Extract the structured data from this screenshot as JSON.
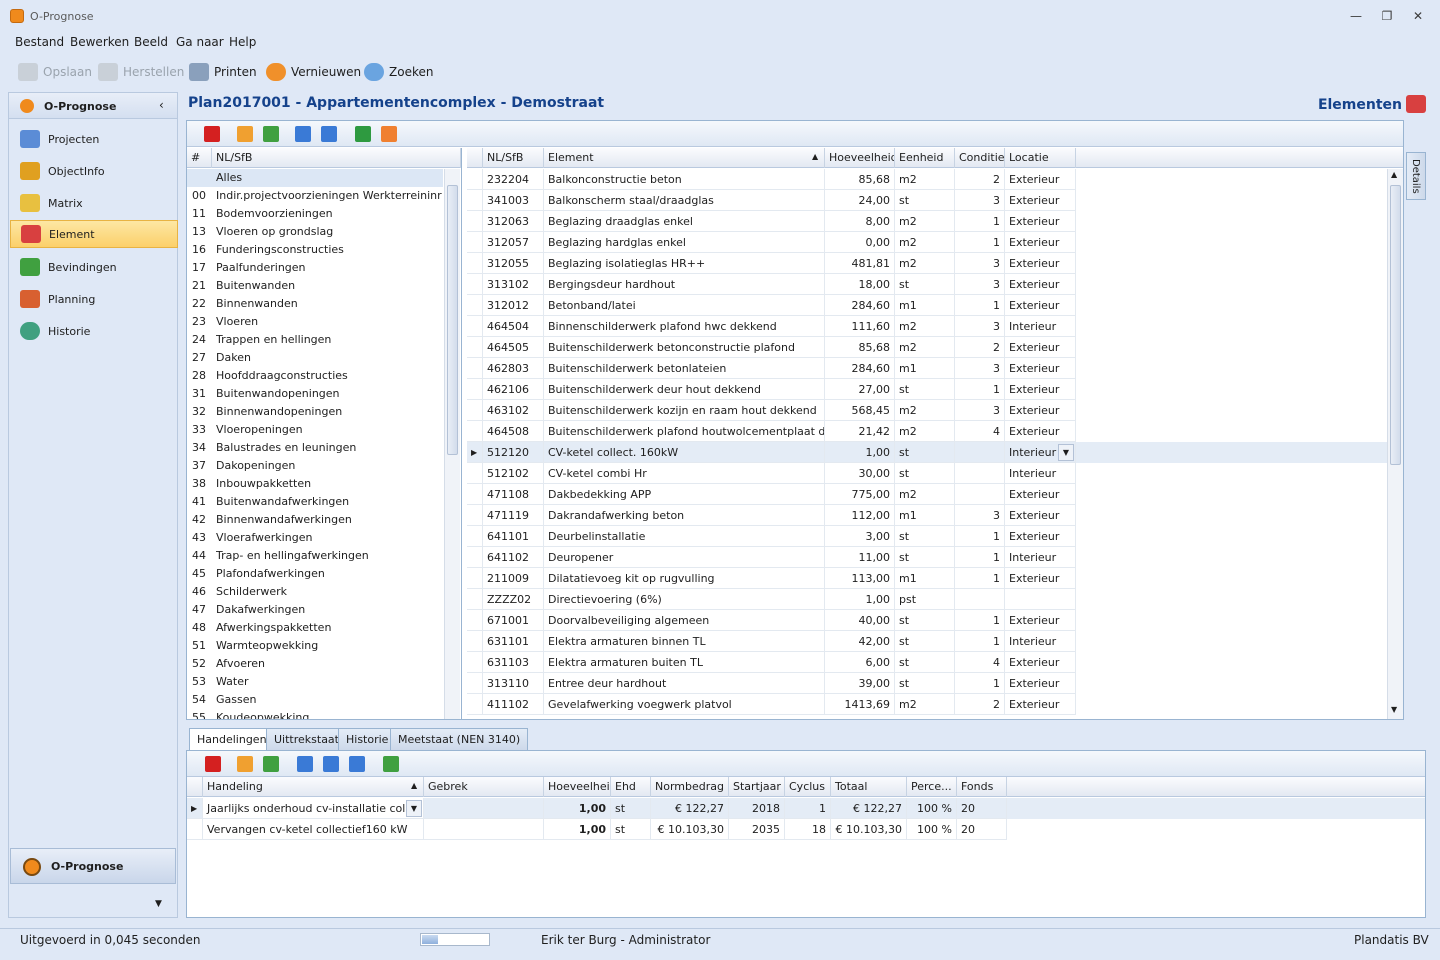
{
  "window": {
    "title": "O-Prognose"
  },
  "menu": [
    "Bestand",
    "Bewerken",
    "Beeld",
    "Ga naar",
    "Help"
  ],
  "toolbar": {
    "save": "Opslaan",
    "restore": "Herstellen",
    "print": "Printen",
    "refresh": "Vernieuwen",
    "search": "Zoeken"
  },
  "nav": {
    "header": "O-Prognose",
    "items": [
      {
        "label": "Projecten",
        "color": "#5b8cd6"
      },
      {
        "label": "ObjectInfo",
        "color": "#e0a020"
      },
      {
        "label": "Matrix",
        "color": "#e8c040"
      },
      {
        "label": "Element",
        "color": "#d84040"
      },
      {
        "label": "Bevindingen",
        "color": "#40a040"
      },
      {
        "label": "Planning",
        "color": "#d86030"
      },
      {
        "label": "Historie",
        "color": "#40a080"
      }
    ],
    "bottom": "O-Prognose"
  },
  "header": {
    "plan": "Plan2017001 - Appartementencomplex - Demostraat",
    "section": "Elementen"
  },
  "details_tab": "Details",
  "left_grid": {
    "headers": [
      "#",
      "NL/SfB"
    ],
    "rows": [
      [
        "",
        "Alles"
      ],
      [
        "00",
        "Indir.projectvoorzieningen Werkterreininrich..."
      ],
      [
        "11",
        "Bodemvoorzieningen"
      ],
      [
        "13",
        "Vloeren op grondslag"
      ],
      [
        "16",
        "Funderingsconstructies"
      ],
      [
        "17",
        "Paalfunderingen"
      ],
      [
        "21",
        "Buitenwanden"
      ],
      [
        "22",
        "Binnenwanden"
      ],
      [
        "23",
        "Vloeren"
      ],
      [
        "24",
        "Trappen en hellingen"
      ],
      [
        "27",
        "Daken"
      ],
      [
        "28",
        "Hoofddraagconstructies"
      ],
      [
        "31",
        "Buitenwandopeningen"
      ],
      [
        "32",
        "Binnenwandopeningen"
      ],
      [
        "33",
        "Vloeropeningen"
      ],
      [
        "34",
        "Balustrades en leuningen"
      ],
      [
        "37",
        "Dakopeningen"
      ],
      [
        "38",
        "Inbouwpakketten"
      ],
      [
        "41",
        "Buitenwandafwerkingen"
      ],
      [
        "42",
        "Binnenwandafwerkingen"
      ],
      [
        "43",
        "Vloerafwerkingen"
      ],
      [
        "44",
        "Trap- en hellingafwerkingen"
      ],
      [
        "45",
        "Plafondafwerkingen"
      ],
      [
        "46",
        "Schilderwerk"
      ],
      [
        "47",
        "Dakafwerkingen"
      ],
      [
        "48",
        "Afwerkingspakketten"
      ],
      [
        "51",
        "Warmteopwekking"
      ],
      [
        "52",
        "Afvoeren"
      ],
      [
        "53",
        "Water"
      ],
      [
        "54",
        "Gassen"
      ],
      [
        "55",
        "Koudeopwekking"
      ]
    ]
  },
  "element_grid": {
    "headers": [
      "NL/SfB",
      "Element",
      "Hoeveelheid",
      "Eenheid",
      "Conditie",
      "Locatie"
    ],
    "rows": [
      [
        "232204",
        "Balkonconstructie beton",
        "85,68",
        "m2",
        "2",
        "Exterieur"
      ],
      [
        "341003",
        "Balkonscherm staal/draadglas",
        "24,00",
        "st",
        "3",
        "Exterieur"
      ],
      [
        "312063",
        "Beglazing draadglas enkel",
        "8,00",
        "m2",
        "1",
        "Exterieur"
      ],
      [
        "312057",
        "Beglazing hardglas enkel",
        "0,00",
        "m2",
        "1",
        "Exterieur"
      ],
      [
        "312055",
        "Beglazing isolatieglas HR++",
        "481,81",
        "m2",
        "3",
        "Exterieur"
      ],
      [
        "313102",
        "Bergingsdeur hardhout",
        "18,00",
        "st",
        "3",
        "Exterieur"
      ],
      [
        "312012",
        "Betonband/latei",
        "284,60",
        "m1",
        "1",
        "Exterieur"
      ],
      [
        "464504",
        "Binnenschilderwerk plafond hwc dekkend",
        "111,60",
        "m2",
        "3",
        "Interieur"
      ],
      [
        "464505",
        "Buitenschilderwerk betonconstructie plafond",
        "85,68",
        "m2",
        "2",
        "Exterieur"
      ],
      [
        "462803",
        "Buitenschilderwerk betonlateien",
        "284,60",
        "m1",
        "3",
        "Exterieur"
      ],
      [
        "462106",
        "Buitenschilderwerk deur hout dekkend",
        "27,00",
        "st",
        "1",
        "Exterieur"
      ],
      [
        "463102",
        "Buitenschilderwerk kozijn en raam hout dekkend",
        "568,45",
        "m2",
        "3",
        "Exterieur"
      ],
      [
        "464508",
        "Buitenschilderwerk plafond houtwolcementplaat dekkend",
        "21,42",
        "m2",
        "4",
        "Exterieur"
      ],
      [
        "512120",
        "CV-ketel collect. 160kW",
        "1,00",
        "st",
        "",
        "Interieur"
      ],
      [
        "512102",
        "CV-ketel combi Hr",
        "30,00",
        "st",
        "",
        "Interieur"
      ],
      [
        "471108",
        "Dakbedekking APP",
        "775,00",
        "m2",
        "",
        "Exterieur"
      ],
      [
        "471119",
        "Dakrandafwerking beton",
        "112,00",
        "m1",
        "3",
        "Exterieur"
      ],
      [
        "641101",
        "Deurbelinstallatie",
        "3,00",
        "st",
        "1",
        "Exterieur"
      ],
      [
        "641102",
        "Deuropener",
        "11,00",
        "st",
        "1",
        "Interieur"
      ],
      [
        "211009",
        "Dilatatievoeg kit op rugvulling",
        "113,00",
        "m1",
        "1",
        "Exterieur"
      ],
      [
        "ZZZZ02",
        "Directievoering (6%)",
        "1,00",
        "pst",
        "",
        ""
      ],
      [
        "671001",
        "Doorvalbeveiliging algemeen",
        "40,00",
        "st",
        "1",
        "Exterieur"
      ],
      [
        "631101",
        "Elektra armaturen binnen TL",
        "42,00",
        "st",
        "1",
        "Interieur"
      ],
      [
        "631103",
        "Elektra armaturen buiten TL",
        "6,00",
        "st",
        "4",
        "Exterieur"
      ],
      [
        "313110",
        "Entree deur hardhout",
        "39,00",
        "st",
        "1",
        "Exterieur"
      ],
      [
        "411102",
        "Gevelafwerking voegwerk platvol",
        "1413,69",
        "m2",
        "2",
        "Exterieur"
      ]
    ]
  },
  "tabs": [
    "Handelingen",
    "Uittrekstaat",
    "Historie",
    "Meetstaat (NEN 3140)"
  ],
  "handelingen": {
    "headers": [
      "Handeling",
      "Gebrek",
      "Hoeveelheid",
      "Ehd",
      "Normbedrag",
      "Startjaar",
      "Cyclus",
      "Totaal",
      "Perce...",
      "Fonds"
    ],
    "rows": [
      [
        "Jaarlijks onderhoud cv-installatie colle...",
        "",
        "1,00",
        "st",
        "€ 122,27",
        "2018",
        "1",
        "€ 122,27",
        "100 %",
        "20"
      ],
      [
        "Vervangen cv-ketel collectief160 kW",
        "",
        "1,00",
        "st",
        "€ 10.103,30",
        "2035",
        "18",
        "€ 10.103,30",
        "100 %",
        "20"
      ]
    ]
  },
  "status": {
    "left": "Uitgevoerd in 0,045 seconden",
    "user": "Erik ter Burg - Administrator",
    "right": "Plandatis BV"
  }
}
